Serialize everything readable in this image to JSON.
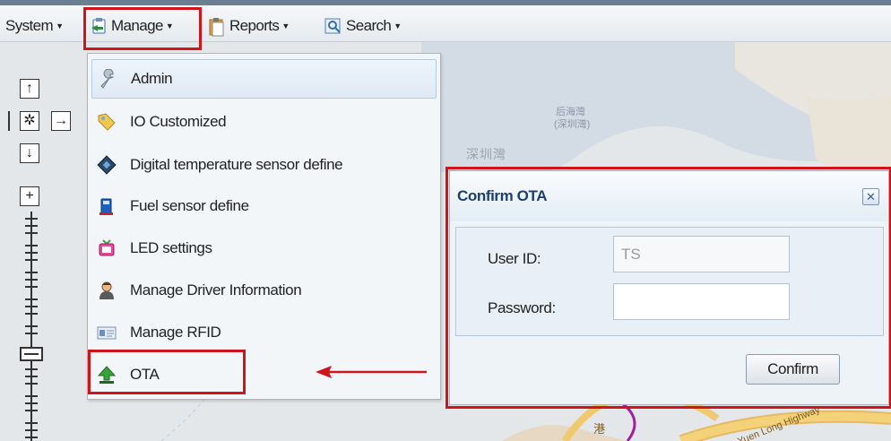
{
  "menubar": {
    "items": [
      {
        "label": "System",
        "icon": "none"
      },
      {
        "label": "Manage",
        "icon": "manage-icon"
      },
      {
        "label": "Reports",
        "icon": "clipboard-icon"
      },
      {
        "label": "Search",
        "icon": "magnifier-icon"
      }
    ]
  },
  "dropdown": {
    "items": [
      {
        "label": "Admin",
        "icon": "wrench-icon"
      },
      {
        "label": "IO Customized",
        "icon": "tag-icon"
      },
      {
        "label": "Digital temperature sensor define",
        "icon": "sensor-chip-icon"
      },
      {
        "label": "Fuel sensor define",
        "icon": "fuel-pump-icon"
      },
      {
        "label": "LED settings",
        "icon": "tv-icon"
      },
      {
        "label": "Manage Driver Information",
        "icon": "driver-icon"
      },
      {
        "label": "Manage RFID",
        "icon": "id-card-icon"
      },
      {
        "label": "OTA",
        "icon": "green-up-arrow-icon"
      }
    ]
  },
  "map": {
    "labels": {
      "bay_cn": "后海灣",
      "bay_sub": "(深圳灣)",
      "place": "深圳灣",
      "road": "Yuen Long Highway",
      "road_char": "港"
    }
  },
  "dialog": {
    "title": "Confirm OTA",
    "close_symbol": "✕",
    "user_id_label": "User ID:",
    "user_id_value": "TS",
    "password_label": "Password:",
    "password_value": "",
    "confirm_label": "Confirm"
  },
  "nav": {
    "up": "↑",
    "pan": "✲",
    "right": "→",
    "down": "↓",
    "zoom_in": "+"
  },
  "colors": {
    "annotation_red": "#d0141c",
    "dialog_title": "#1d3f6e"
  }
}
